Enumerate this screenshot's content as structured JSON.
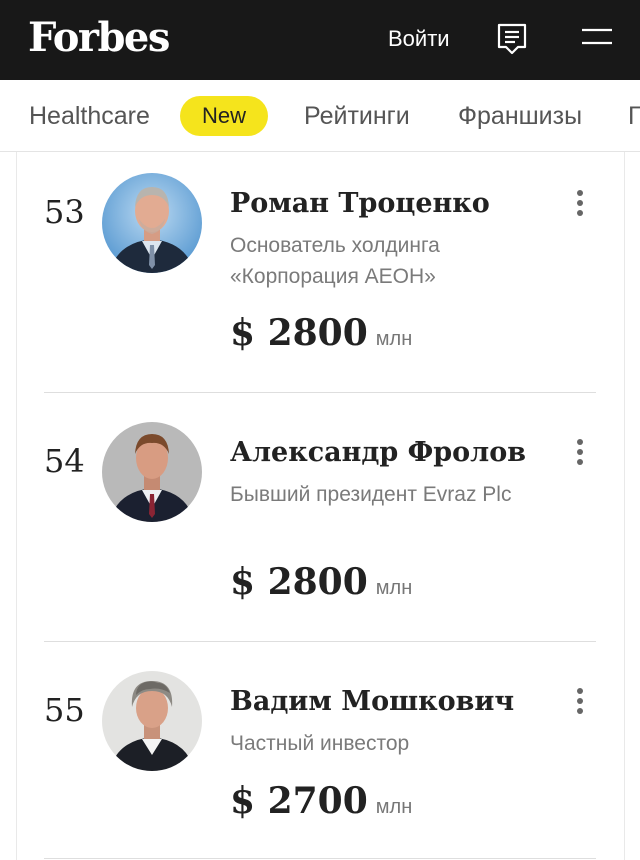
{
  "header": {
    "logo": "Forbes",
    "login_label": "Войти",
    "list_icon": "document-list-icon",
    "menu_icon": "hamburger-menu-icon",
    "background": "#181818"
  },
  "nav": {
    "items": [
      "Healthcare",
      "Рейтинги",
      "Франшизы",
      "Г"
    ],
    "badge": "New",
    "badge_color": "#f5e41c"
  },
  "ranking": [
    {
      "rank": "53",
      "name": "Роман Троценко",
      "description": "Основатель холдинга «Корпорация АЕОН»",
      "amount": "$ 2800",
      "unit": "млн"
    },
    {
      "rank": "54",
      "name": "Александр Фролов",
      "description": "Бывший президент Evraz Plc",
      "amount": "$ 2800",
      "unit": "млн"
    },
    {
      "rank": "55",
      "name": "Вадим Мошкович",
      "description": "Частный инвестор",
      "amount": "$ 2700",
      "unit": "млн"
    }
  ]
}
